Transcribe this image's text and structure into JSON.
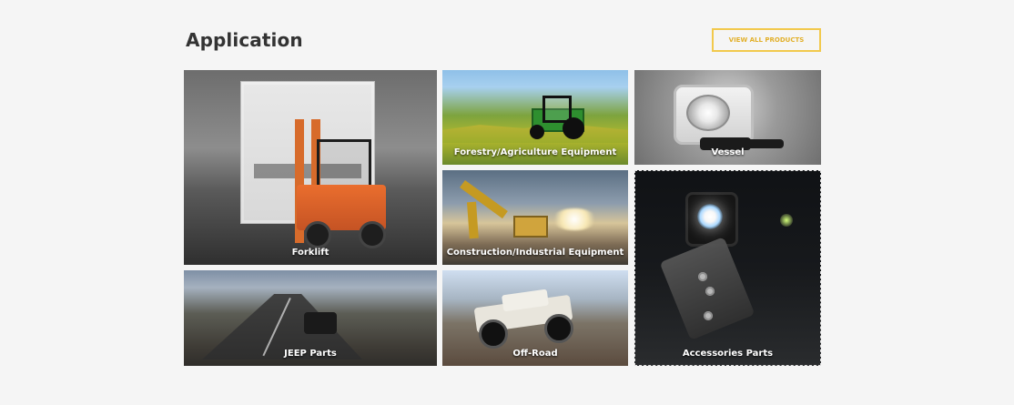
{
  "section": {
    "title": "Application",
    "view_all_label": "VIEW ALL PRODUCTS"
  },
  "tiles": [
    {
      "label": "Forklift"
    },
    {
      "label": "Forestry/Agriculture Equipment"
    },
    {
      "label": "Vessel"
    },
    {
      "label": "Construction/Industrial Equipment"
    },
    {
      "label": "JEEP Parts"
    },
    {
      "label": "Off-Road"
    },
    {
      "label": "Accessories Parts"
    }
  ],
  "colors": {
    "background": "#f5f5f5",
    "title": "#333333",
    "accent": "#f2c94c"
  }
}
